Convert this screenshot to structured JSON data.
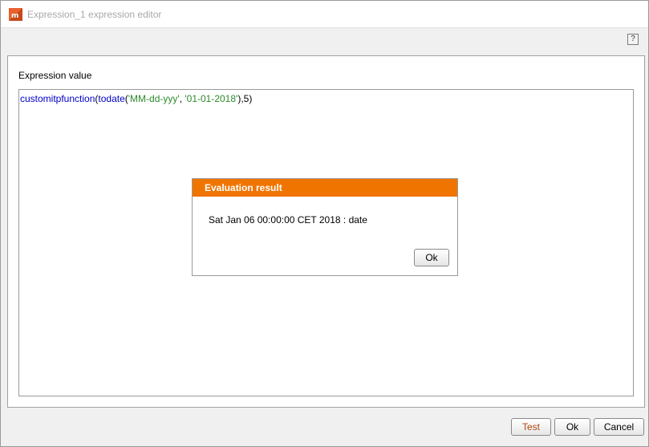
{
  "window": {
    "title": "Expression_1 expression editor",
    "help_label": "?"
  },
  "panel": {
    "label": "Expression value"
  },
  "editor": {
    "tokens": {
      "fn1": "customitpfunction",
      "p1": "(",
      "fn2": "todate",
      "p2": "(",
      "s1": "'MM-dd-yyy'",
      "p3": ", ",
      "s2": "'01-01-2018'",
      "p4": "),",
      "n1": "5",
      "p5": ")"
    }
  },
  "dialog": {
    "title": "Evaluation result",
    "message": "Sat Jan 06 00:00:00 CET 2018 : date",
    "ok_label": "Ok"
  },
  "footer": {
    "test_label": "Test",
    "ok_label": "Ok",
    "cancel_label": "Cancel"
  },
  "colors": {
    "accent": "#f07400",
    "function_token": "#0000c8",
    "string_token": "#2a8a2a"
  }
}
